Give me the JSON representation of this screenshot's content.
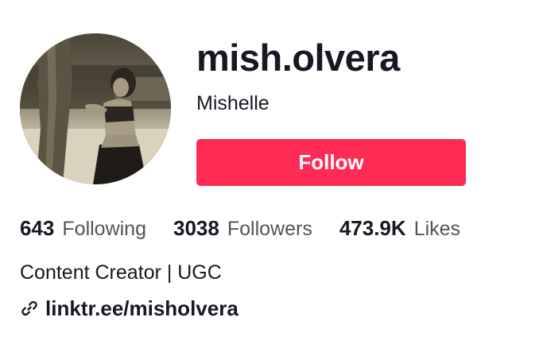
{
  "profile": {
    "username": "mish.olvera",
    "display_name": "Mishelle",
    "avatar_alt": "profile photo"
  },
  "actions": {
    "follow_label": "Follow"
  },
  "stats": {
    "following": {
      "count": "643",
      "label": "Following"
    },
    "followers": {
      "count": "3038",
      "label": "Followers"
    },
    "likes": {
      "count": "473.9K",
      "label": "Likes"
    }
  },
  "bio": {
    "text": "Content Creator | UGC",
    "link_icon": "link-icon",
    "link_text": "linktr.ee/misholvera"
  },
  "colors": {
    "accent": "#fe2c55",
    "text_primary": "#161823",
    "text_secondary": "rgba(22, 24, 35, 0.75)",
    "background": "#ffffff"
  }
}
